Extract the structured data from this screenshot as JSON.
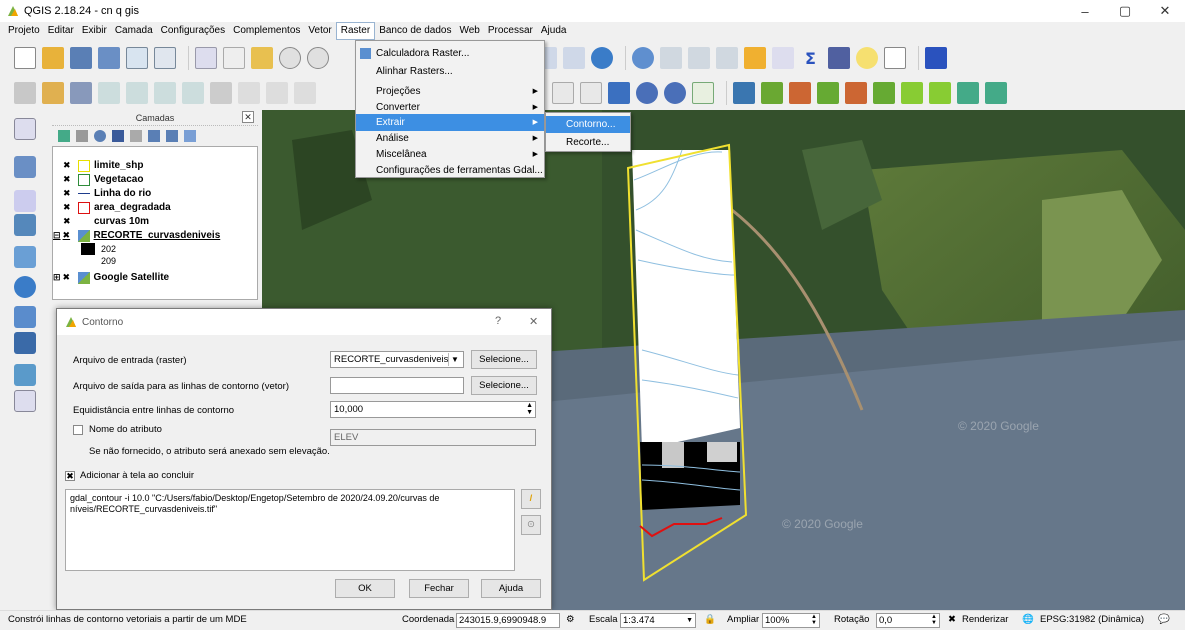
{
  "window": {
    "title": "QGIS 2.18.24 - cn q gis",
    "minimize": "–",
    "maximize": "▢",
    "close": "✕"
  },
  "menubar": {
    "items": [
      "Projeto",
      "Editar",
      "Exibir",
      "Camada",
      "Configurações",
      "Complementos",
      "Vetor",
      "Raster",
      "Banco de dados",
      "Web",
      "Processar",
      "Ajuda"
    ],
    "active": "Raster"
  },
  "raster_menu": {
    "items": [
      {
        "label": "Calculadora Raster..."
      },
      {
        "label": "Alinhar Rasters..."
      },
      {
        "label": "Projeções",
        "submenu": true
      },
      {
        "label": "Converter",
        "submenu": true
      },
      {
        "label": "Extrair",
        "submenu": true,
        "highlighted": true
      },
      {
        "label": "Análise",
        "submenu": true
      },
      {
        "label": "Miscelânea",
        "submenu": true
      },
      {
        "label": "Configurações de ferramentas Gdal..."
      }
    ],
    "extrair_submenu": [
      {
        "label": "Contorno...",
        "highlighted": true
      },
      {
        "label": "Recorte..."
      }
    ]
  },
  "layers_panel": {
    "title": "Camadas",
    "layers": [
      {
        "name": "limite_shp",
        "symbol": "yellow-outline"
      },
      {
        "name": "Vegetacao",
        "symbol": "green-outline"
      },
      {
        "name": "Linha do rio",
        "symbol": "blue-line"
      },
      {
        "name": "area_degradada",
        "symbol": "red-outline"
      },
      {
        "name": "curvas 10m",
        "symbol": "none"
      },
      {
        "name": "RECORTE_curvasdeniveis",
        "symbol": "raster"
      },
      {
        "name": "Google Satellite",
        "symbol": "raster"
      }
    ],
    "legend": [
      {
        "label": "202",
        "color": "#000000"
      },
      {
        "label": "209",
        "color": "#ffffff"
      }
    ]
  },
  "dialog": {
    "title": "Contorno",
    "help": "?",
    "close": "✕",
    "input_label": "Arquivo de entrada (raster)",
    "input_value": "RECORTE_curvasdeniveis",
    "select_label": "Selecione...",
    "output_label": "Arquivo de saída para as linhas de contorno (vetor)",
    "output_value": "",
    "interval_label": "Equidistância entre linhas de contorno",
    "interval_value": "10,000",
    "attr_label": "Nome do atributo",
    "attr_note": "Se não fornecido, o atributo será anexado sem elevação.",
    "attr_value": "ELEV",
    "add_label": "Adicionar à tela ao concluir",
    "command": "gdal_contour -i 10.0 \"C:/Users/fabio/Desktop/Engetop/Setembro de 2020/24.09.20/curvas de níveis/RECORTE_curvasdeniveis.tif\"",
    "ok": "OK",
    "cancel": "Fechar",
    "help_btn": "Ajuda"
  },
  "map": {
    "watermark1": "© 2020 Google",
    "watermark2": "© 2020 Google"
  },
  "statusbar": {
    "message": "Constrói linhas de contorno vetoriais a partir de um MDE",
    "coord_label": "Coordenada",
    "coord_value": "243015.9,6990948.9",
    "scale_label": "Escala",
    "scale_value": "1:3.474",
    "zoom_label": "Ampliar",
    "zoom_value": "100%",
    "rotation_label": "Rotação",
    "rotation_value": "0,0",
    "render_label": "Renderizar",
    "crs": "EPSG:31982 (Dinâmica)"
  }
}
